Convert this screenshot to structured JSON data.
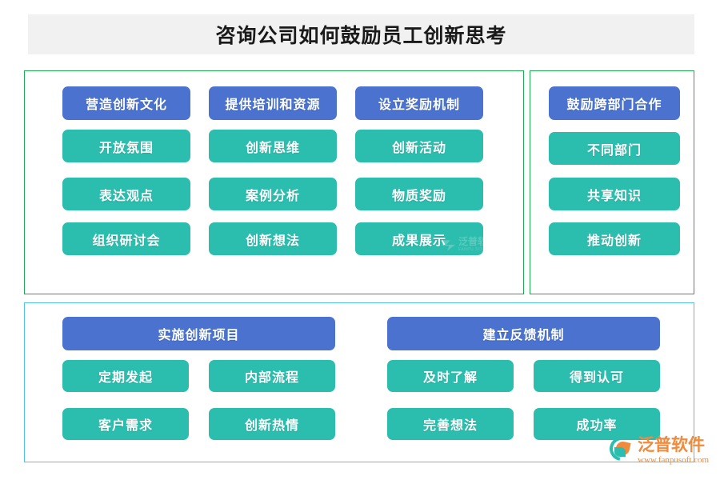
{
  "title": "咨询公司如何鼓励员工创新思考",
  "colors": {
    "header_blue": "#4a72ce",
    "item_teal": "#2bbdad",
    "panel_green_border": "#1faa55",
    "panel_cyan_border": "#4ec3ef",
    "banner_bg": "#f1f1f1",
    "logo_orange": "#f08a3c"
  },
  "panels": {
    "main": {
      "columns": [
        {
          "header": "营造创新文化",
          "items": [
            "开放氛围",
            "表达观点",
            "组织研讨会"
          ]
        },
        {
          "header": "提供培训和资源",
          "items": [
            "创新思维",
            "案例分析",
            "创新想法"
          ]
        },
        {
          "header": "设立奖励机制",
          "items": [
            "创新活动",
            "物质奖励",
            "成果展示"
          ]
        }
      ]
    },
    "cross": {
      "header": "鼓励跨部门合作",
      "items": [
        "不同部门",
        "共享知识",
        "推动创新"
      ]
    },
    "bottom": {
      "groups": [
        {
          "header": "实施创新项目",
          "items": [
            "定期发起",
            "内部流程",
            "客户需求",
            "创新热情"
          ]
        },
        {
          "header": "建立反馈机制",
          "items": [
            "及时了解",
            "得到认可",
            "完善想法",
            "成功率"
          ]
        }
      ]
    }
  },
  "watermark": {
    "inline_cn": "泛普软件",
    "inline_en": "FANPU SOFTWARE"
  },
  "logo": {
    "name": "泛普软件",
    "url": "www.fanpusoft.com"
  }
}
